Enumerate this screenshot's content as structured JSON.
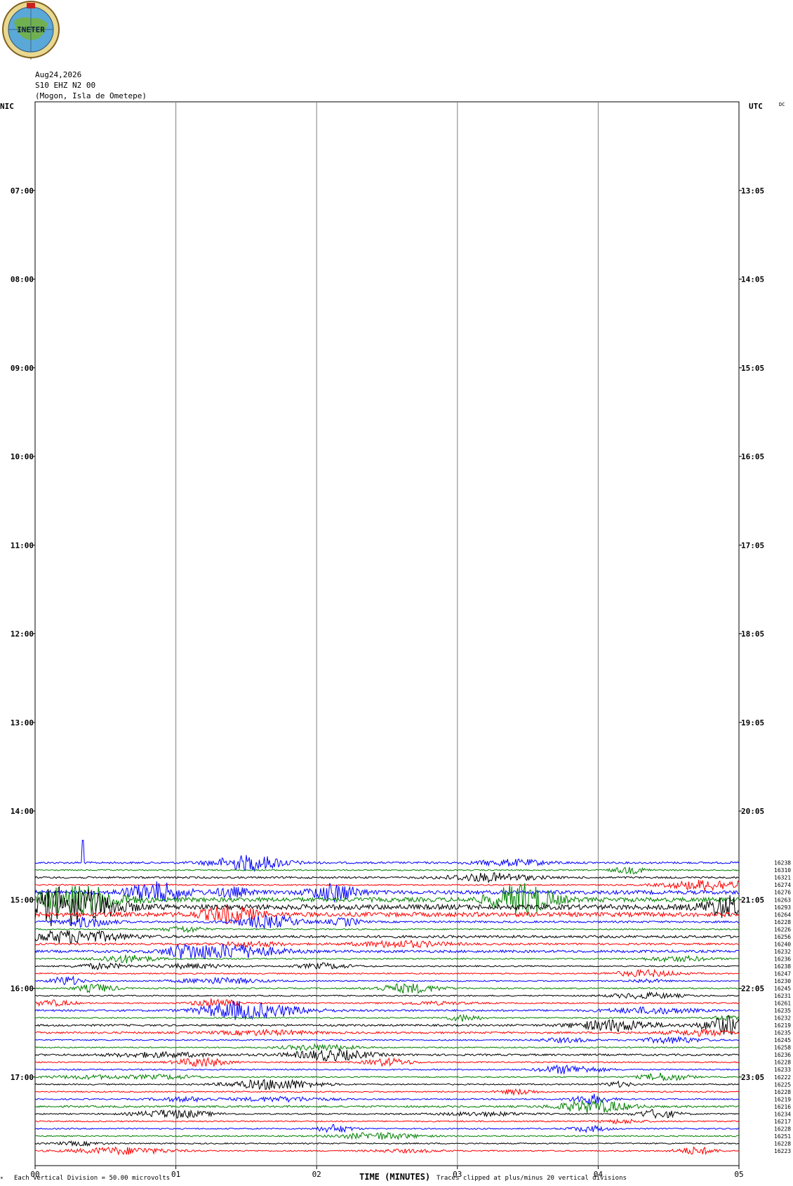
{
  "logo": {
    "text": "INETER"
  },
  "header": {
    "date": "Aug24,2026",
    "station": "S10 EHZ N2 00",
    "location": "(Mogon, Isla de Ometepe)"
  },
  "chart_data": {
    "type": "line",
    "title": "",
    "left_axis_label": "NIC",
    "right_axis_label": "UTC",
    "corner_label": "DC",
    "xlabel": "TIME (MINUTES)",
    "xlim": [
      0,
      5
    ],
    "x_ticks": [
      "00",
      "01",
      "02",
      "03",
      "04",
      "05"
    ],
    "left_time_ticks": [
      "07:00",
      "08:00",
      "09:00",
      "10:00",
      "11:00",
      "12:00",
      "13:00",
      "14:00",
      "15:00",
      "16:00",
      "17:00"
    ],
    "right_time_ticks": [
      "13:05",
      "14:05",
      "15:05",
      "16:05",
      "17:05",
      "18:05",
      "19:05",
      "20:05",
      "21:05",
      "22:05",
      "23:05"
    ],
    "time_range_hours": [
      6.0,
      18.0
    ],
    "trace_interval_minutes": 5,
    "first_trace_time": "14:35",
    "trace_colors": [
      "#0000ff",
      "#008000",
      "#000000",
      "#ff0000"
    ],
    "trace_counts": [
      "16238",
      "16310",
      "16321",
      "16274",
      "16276",
      "16263",
      "16293",
      "16264",
      "16228",
      "16226",
      "16256",
      "16240",
      "16232",
      "16236",
      "16238",
      "16247",
      "16230",
      "16245",
      "16231",
      "16261",
      "16235",
      "16232",
      "16219",
      "16235",
      "16245",
      "16258",
      "16236",
      "16228",
      "16233",
      "16222",
      "16225",
      "16228",
      "16219",
      "16216",
      "16234",
      "16217",
      "16228",
      "16251",
      "16228",
      "16223"
    ],
    "trace_amplitude": [
      3,
      2,
      3,
      2,
      6,
      7,
      8,
      7,
      3,
      2,
      4,
      3,
      4,
      2,
      2,
      2,
      2,
      2,
      2,
      2,
      3,
      2,
      3,
      3,
      2,
      2,
      3,
      2,
      2,
      2,
      2,
      2,
      2,
      3,
      2,
      2,
      2,
      2,
      2,
      2
    ],
    "footer_left": "Each Vertical Division =   50.00 microvolts",
    "footer_right": "Traces clipped at plus/minus 20 vertical divisions"
  },
  "colors": {
    "grid": "#808080",
    "frame": "#000000"
  }
}
